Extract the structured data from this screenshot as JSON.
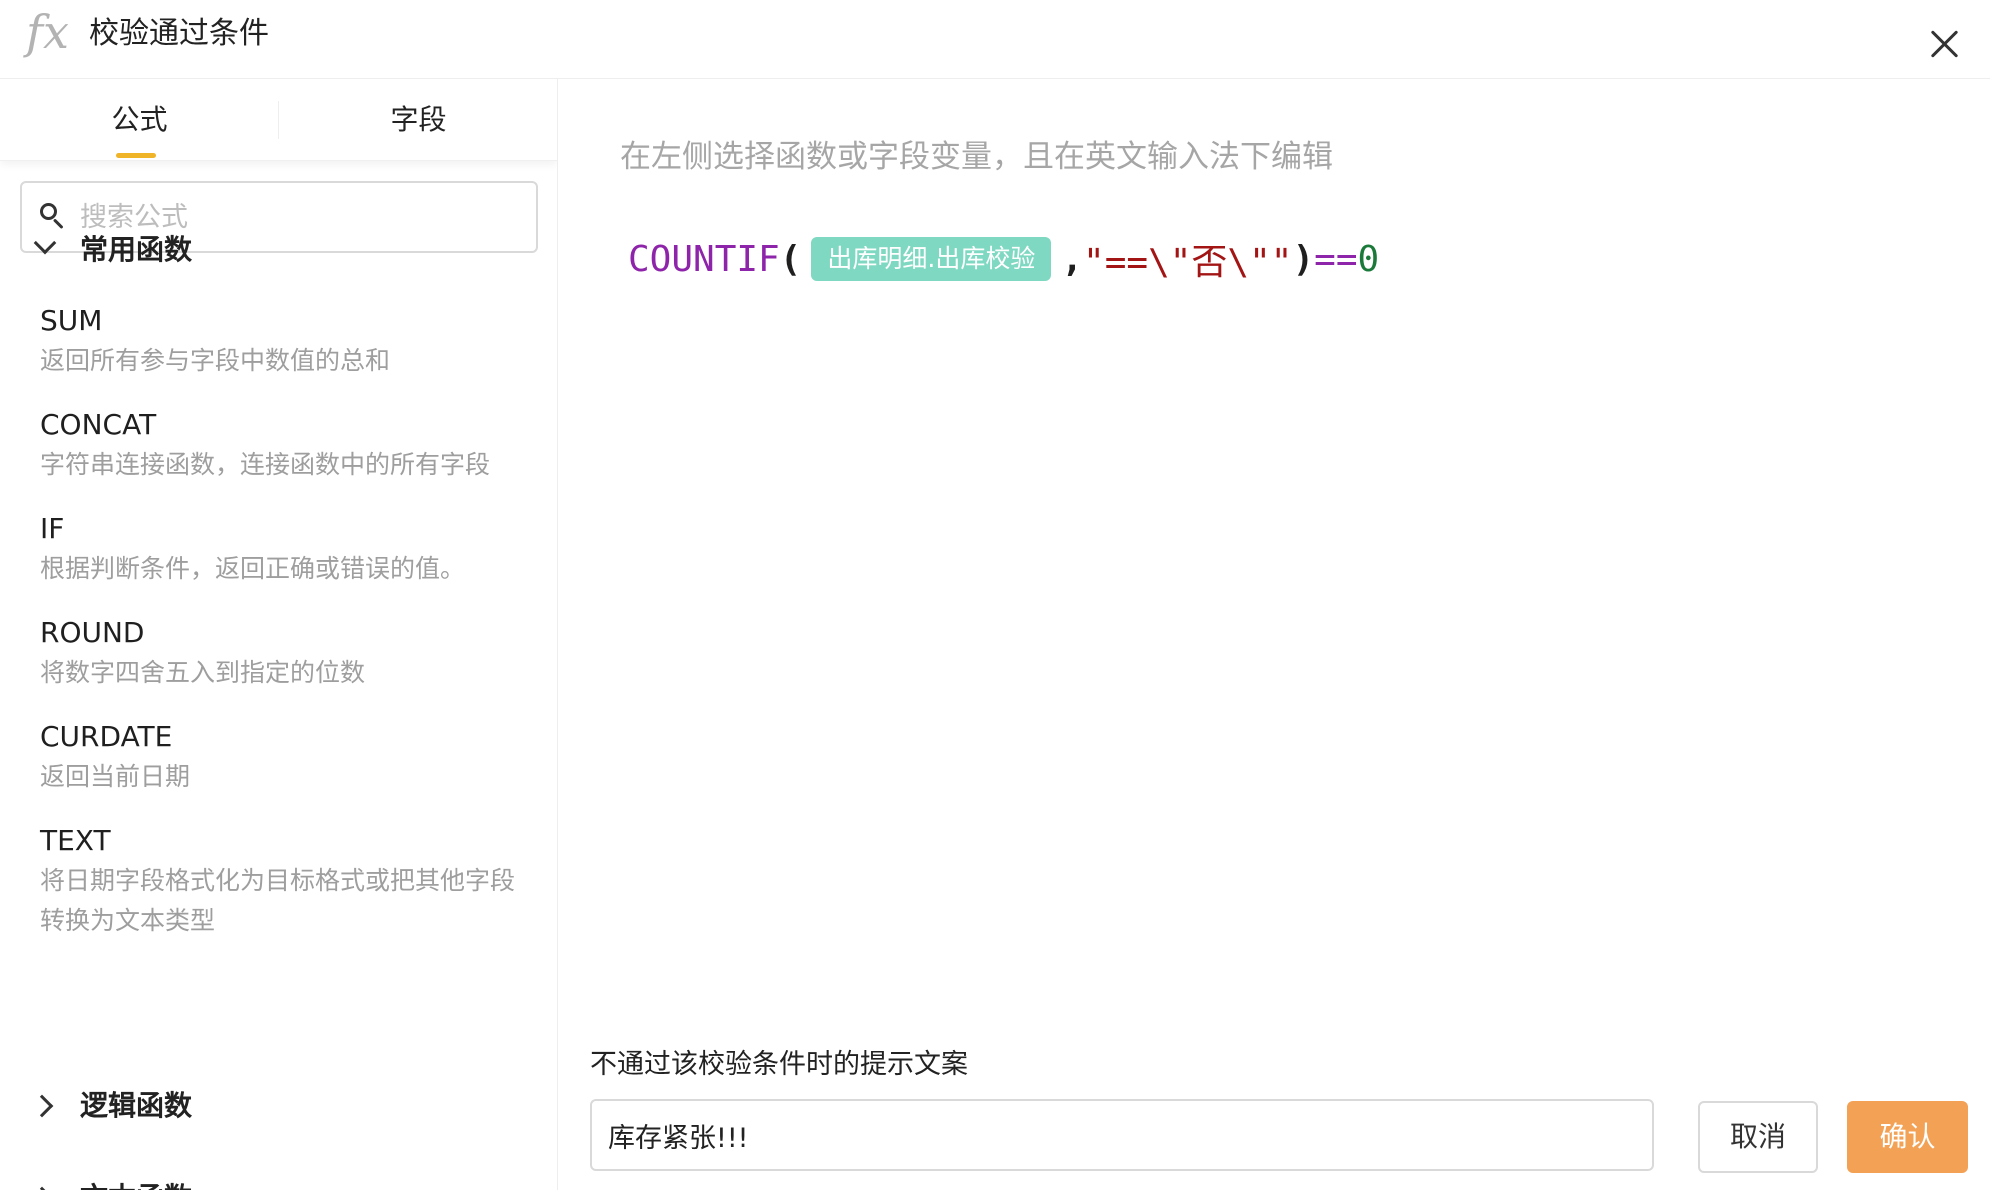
{
  "dialog": {
    "title": "校验通过条件",
    "fx_label": "fx"
  },
  "tabs": [
    {
      "label": "公式",
      "active": true
    },
    {
      "label": "字段",
      "active": false
    }
  ],
  "search": {
    "placeholder": "搜索公式",
    "value": ""
  },
  "groups": {
    "common": {
      "label": "常用函数",
      "expanded": true
    },
    "logic": {
      "label": "逻辑函数",
      "expanded": false
    },
    "text": {
      "label": "文本函数",
      "expanded": false
    }
  },
  "functions": [
    {
      "name": "SUM",
      "desc": "返回所有参与字段中数值的总和"
    },
    {
      "name": "CONCAT",
      "desc": "字符串连接函数，连接函数中的所有字段"
    },
    {
      "name": "IF",
      "desc": "根据判断条件，返回正确或错误的值。"
    },
    {
      "name": "ROUND",
      "desc": "将数字四舍五入到指定的位数"
    },
    {
      "name": "CURDATE",
      "desc": "返回当前日期"
    },
    {
      "name": "TEXT",
      "desc": "将日期字段格式化为目标格式或把其他字段转换为文本类型"
    }
  ],
  "editor": {
    "hint": "在左侧选择函数或字段变量，且在英文输入法下编辑",
    "formula": {
      "fn": "COUNTIF",
      "open": "(",
      "field": "出库明细.出库校验",
      "comma": ",",
      "string": "\"==\\\"否\\\"\"",
      "close": ")",
      "op": "==",
      "num": "0"
    }
  },
  "message": {
    "label": "不通过该校验条件时的提示文案",
    "value": "库存紧张!!!"
  },
  "buttons": {
    "cancel": "取消",
    "confirm": "确认"
  },
  "colors": {
    "accent": "#f3a154",
    "tab_underline": "#f0b429",
    "field_chip": "#7fd8c1",
    "function": "#8e24aa",
    "string": "#a31515",
    "number": "#1b7a3a"
  }
}
